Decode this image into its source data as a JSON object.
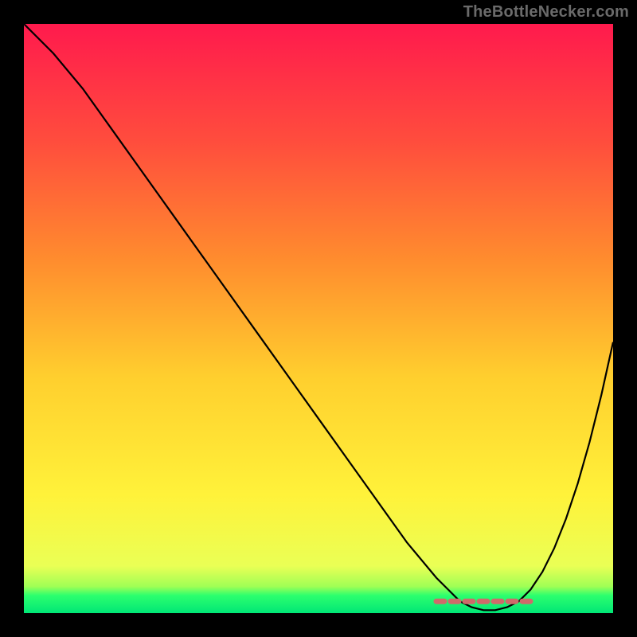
{
  "watermark": "TheBottleNecker.com",
  "chart_data": {
    "type": "line",
    "title": "",
    "xlabel": "",
    "ylabel": "",
    "xlim": [
      0,
      100
    ],
    "ylim": [
      0,
      100
    ],
    "grid": false,
    "background": "red-yellow-green gradient with green band at bottom",
    "series": [
      {
        "name": "curve",
        "color": "#000000",
        "x": [
          0,
          5,
          10,
          15,
          20,
          25,
          30,
          35,
          40,
          45,
          50,
          55,
          60,
          65,
          70,
          72,
          74,
          76,
          78,
          80,
          82,
          84,
          86,
          88,
          90,
          92,
          94,
          96,
          98,
          100
        ],
        "values": [
          100,
          95,
          89,
          82,
          75,
          68,
          61,
          54,
          47,
          40,
          33,
          26,
          19,
          12,
          6,
          4,
          2,
          1,
          0.5,
          0.5,
          1,
          2,
          4,
          7,
          11,
          16,
          22,
          29,
          37,
          46
        ]
      },
      {
        "name": "bottleneck-band",
        "color": "#cf6a6a",
        "x": [
          70,
          72,
          74,
          76,
          78,
          80,
          82,
          84,
          86
        ],
        "values": [
          2,
          2,
          2,
          2,
          2,
          2,
          2,
          2,
          2
        ]
      }
    ],
    "note": "Values estimated from pixel positions; no axis ticks or labels are shown in the image."
  },
  "gradient": {
    "stops": [
      {
        "offset": 0.0,
        "color": "#ff1a4d"
      },
      {
        "offset": 0.2,
        "color": "#ff4d3d"
      },
      {
        "offset": 0.4,
        "color": "#ff8c2e"
      },
      {
        "offset": 0.6,
        "color": "#ffcf2e"
      },
      {
        "offset": 0.8,
        "color": "#fff23a"
      },
      {
        "offset": 0.92,
        "color": "#eaff55"
      },
      {
        "offset": 0.955,
        "color": "#9fff55"
      },
      {
        "offset": 0.97,
        "color": "#2cff6e"
      },
      {
        "offset": 1.0,
        "color": "#00e676"
      }
    ]
  }
}
